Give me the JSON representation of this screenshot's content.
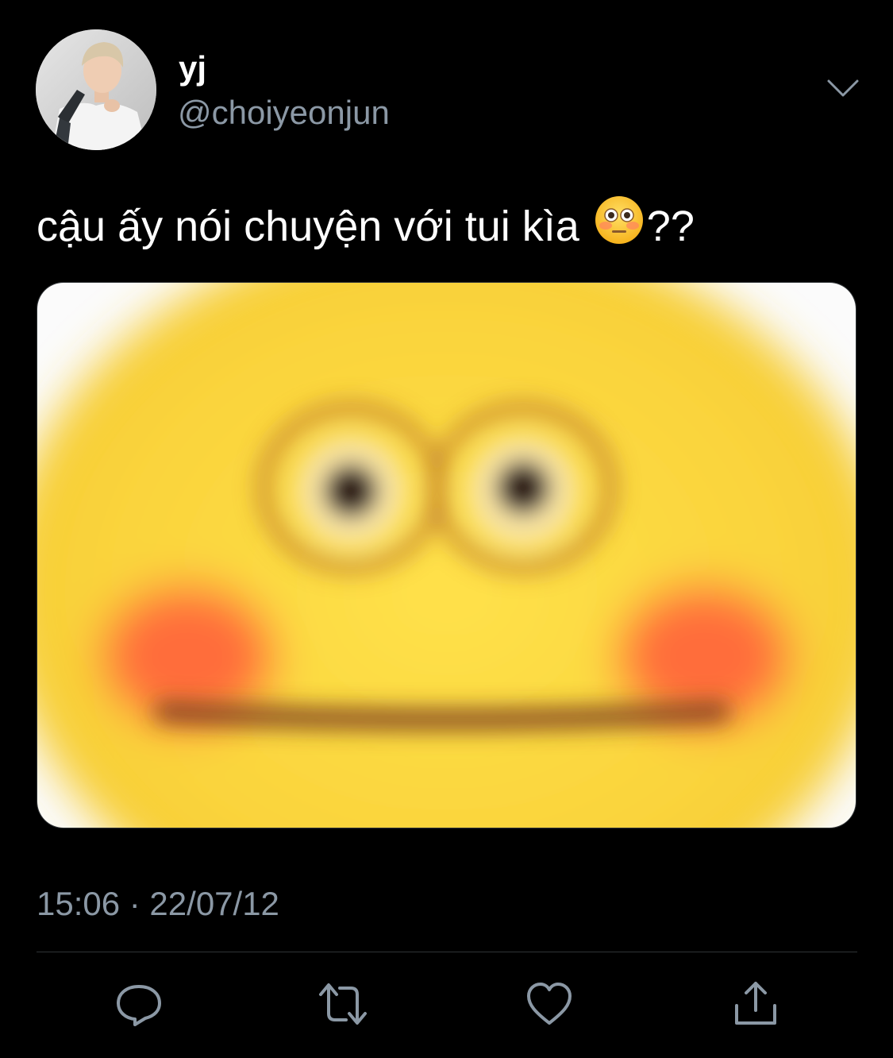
{
  "author": {
    "display_name": "yj",
    "handle": "@choiyeonjun"
  },
  "tweet": {
    "text_before_emoji": "cậu ấy nói chuyện với tui kìa",
    "emoji": "flushed-face",
    "text_after_emoji": "??",
    "media": {
      "description_icon": "blurred-flushed-emoji-image"
    },
    "timestamp": "15:06 · 22/07/12"
  },
  "actions": [
    {
      "icon": "reply-icon"
    },
    {
      "icon": "retweet-icon"
    },
    {
      "icon": "like-icon"
    },
    {
      "icon": "share-icon"
    }
  ],
  "colors": {
    "background": "#000000",
    "primary_text": "#ffffff",
    "secondary_text": "#8b98a5",
    "divider": "#2f3336"
  }
}
